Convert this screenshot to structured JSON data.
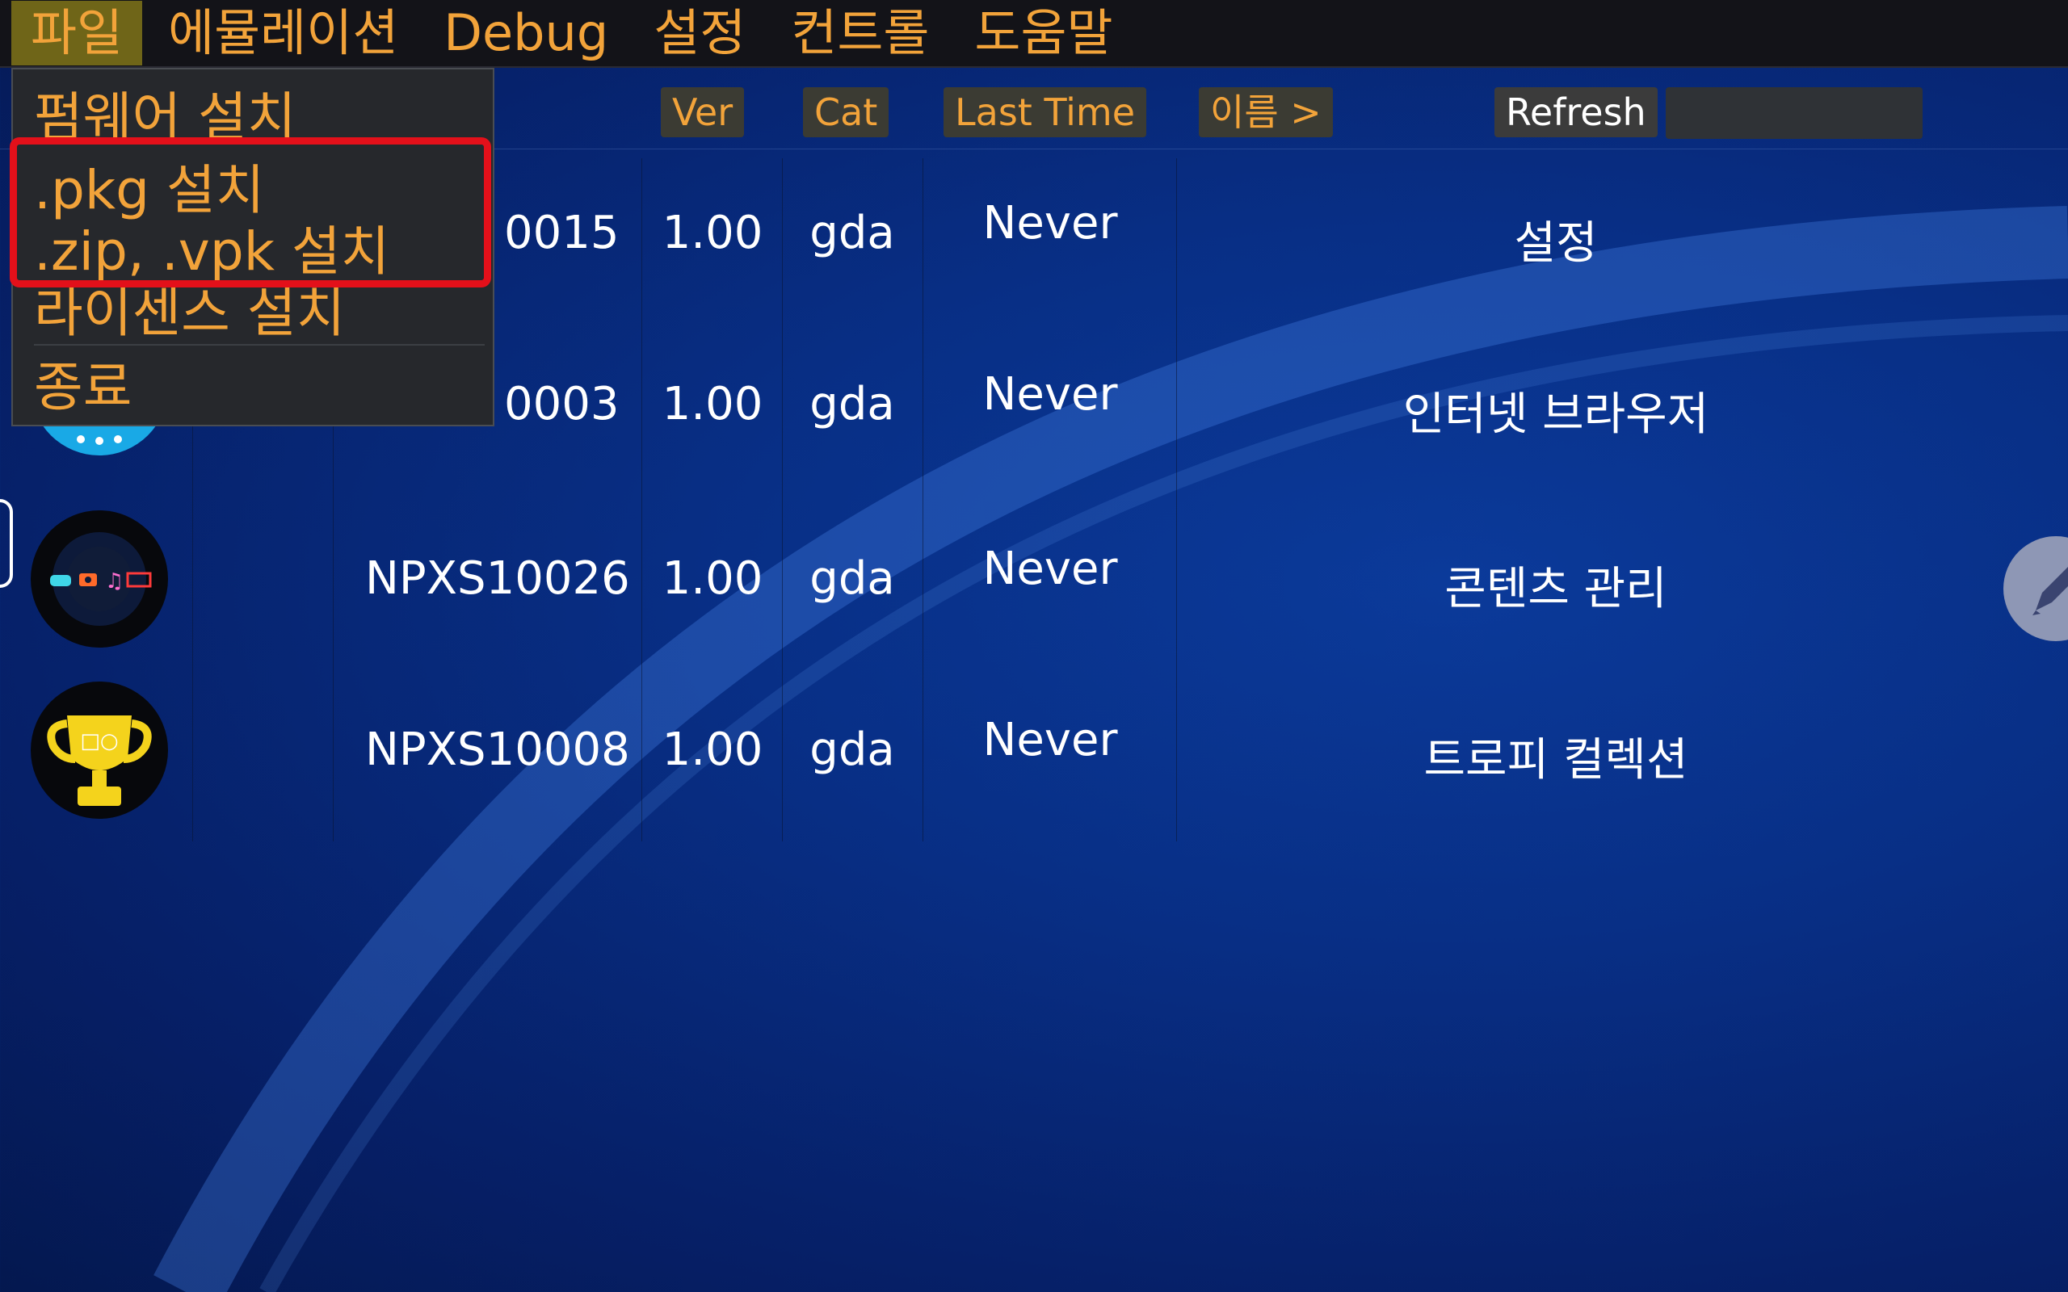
{
  "menubar": {
    "items": [
      "파일",
      "에뮬레이션",
      "Debug",
      "설정",
      "컨트롤",
      "도움말"
    ],
    "active_index": 0
  },
  "file_menu": {
    "items": [
      "펌웨어 설치",
      ".pkg 설치",
      ".zip, .vpk 설치",
      "라이센스 설치",
      "종료"
    ]
  },
  "header": {
    "ver": "Ver",
    "cat": "Cat",
    "last_time": "Last Time",
    "name_sort": "이름 >",
    "refresh": "Refresh",
    "search_placeholder": ""
  },
  "apps": [
    {
      "title_id": "0015",
      "ver": "1.00",
      "cat": "gda",
      "last_time": "Never",
      "name": "설정",
      "icon": "settings-icon"
    },
    {
      "title_id": "0003",
      "ver": "1.00",
      "cat": "gda",
      "last_time": "Never",
      "name": "인터넷 브라우저",
      "icon": "browser-icon"
    },
    {
      "title_id": "NPXS10026",
      "ver": "1.00",
      "cat": "gda",
      "last_time": "Never",
      "name": "콘텐츠 관리",
      "icon": "content-manager-icon"
    },
    {
      "title_id": "NPXS10008",
      "ver": "1.00",
      "cat": "gda",
      "last_time": "Never",
      "name": "트로피 컬렉션",
      "icon": "trophy-icon"
    }
  ],
  "colors": {
    "menu_text": "#f2a33a",
    "menu_active_bg": "#6f6518",
    "highlight": "#e3101a",
    "background": "#082f86"
  }
}
